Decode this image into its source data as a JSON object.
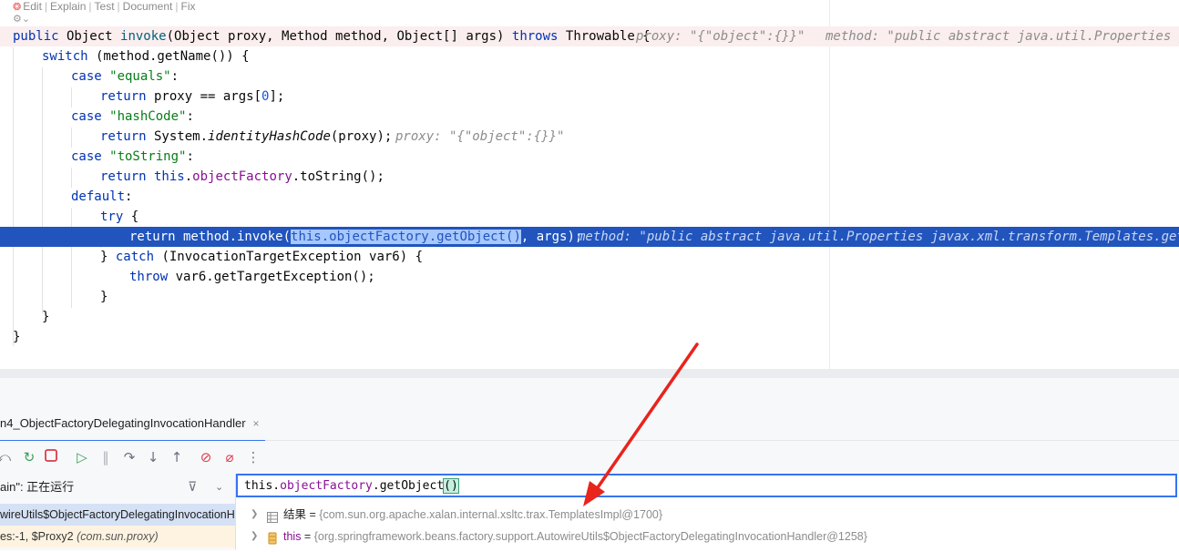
{
  "codelens": {
    "edit": "Edit",
    "explain": "Explain",
    "test": "Test",
    "document": "Document",
    "fix": "Fix"
  },
  "code": {
    "l1_kw_public": "public",
    "l1_a": " Object ",
    "l1_m": "invoke",
    "l1_b": "(Object proxy, Method method, Object[] args) ",
    "l1_kw_throws": "throws",
    "l1_c": " Throwable {",
    "l1_hint_proxy": "proxy: \"{\"object\":{}}\"",
    "l1_hint_method": "method: \"public abstract java.util.Properties jav",
    "l2_kw": "switch",
    "l2_rest": " (method.getName()) {",
    "l3_kw": "case",
    "l3_str": " \"equals\"",
    "l3_end": ":",
    "l4_kw": "return",
    "l4_a": " proxy == args[",
    "l4_num": "0",
    "l4_b": "];",
    "l5_kw": "case",
    "l5_str": " \"hashCode\"",
    "l5_end": ":",
    "l6_kw": "return",
    "l6_a": " System.",
    "l6_it": "identityHashCode",
    "l6_b": "(proxy);",
    "l6_hint": "proxy: \"{\"object\":{}}\"",
    "l7_kw": "case",
    "l7_str": " \"toString\"",
    "l7_end": ":",
    "l8_kw": "return",
    "l8_kw2": " this",
    "l8_dot": ".",
    "l8_fld": "objectFactory",
    "l8_b": ".toString();",
    "l9_kw": "default",
    "l9_end": ":",
    "l10_kw": "try",
    "l10_end": " {",
    "l11_a": "return method.invoke(",
    "l11_sel": "this.objectFactory.getObject()",
    "l11_b": ", args);",
    "l11_hint": "method: \"public abstract java.util.Properties javax.xml.transform.Templates.getOutp",
    "l12_a": "} ",
    "l12_kw": "catch",
    "l12_b": " (InvocationTargetException var6) {",
    "l13_kw": "throw",
    "l13_b": " var6.getTargetException();",
    "l14": "}",
    "l15": "}",
    "l16": "}"
  },
  "debug_tab": {
    "label": "n4_ObjectFactoryDelegatingInvocationHandler",
    "close": "×"
  },
  "threads": {
    "label": "ain\": 正在运行"
  },
  "frames": [
    {
      "label": "wireUtils$ObjectFactoryDelegatingInvocationH"
    },
    {
      "label_a": "es:-1, $Proxy2 ",
      "label_b": "(com.sun.proxy)"
    }
  ],
  "evaluate": {
    "a": "this.",
    "fld": "objectFactory",
    "b": ".getObject",
    "paren": "()"
  },
  "variables": [
    {
      "name": "结果",
      "eq": " = ",
      "value": "{com.sun.org.apache.xalan.internal.xsltc.trax.TemplatesImpl@1700}"
    },
    {
      "name": "this",
      "eq": " = ",
      "value": "{org.springframework.beans.factory.support.AutowireUtils$ObjectFactoryDelegatingInvocationHandler@1258}"
    }
  ],
  "colors": {
    "exec_line": "#2154bd",
    "accent": "#3574f0",
    "annotation_arrow": "#e8241c"
  }
}
